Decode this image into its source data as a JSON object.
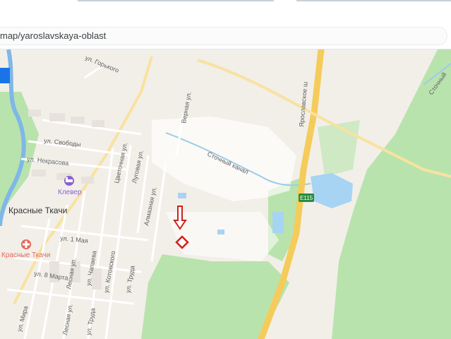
{
  "browser": {
    "url": "map/yaroslavskaya-oblast"
  },
  "map": {
    "colors": {
      "forest": "#b9e3ad",
      "water": "#a7d4f2",
      "highway": "#f5cc5b",
      "marker": "#d0201a",
      "poi": "#8a63d2",
      "hospital": "#e2675b"
    },
    "labels": {
      "town": "Красные Ткачи",
      "poi_klever": "Клевер",
      "poi_clinic": "Красные Ткачи",
      "highway_shield": "E115",
      "road_yaroslavskoe": "Ярославское ш",
      "canal": "Сточный канал",
      "canal_right": "Сточный",
      "st_gorkogo": "ул. Горького",
      "st_svobody": "ул. Свободы",
      "st_nekrasova": "ул. Некрасова",
      "st_1maya": "ул. 1 Мая",
      "st_8marta": "ул. 8 Марта",
      "st_mira": "ул. Мира",
      "st_tsvetochnaya": "Цветочная ул.",
      "st_lugovaya": "Луговая ул.",
      "st_almaznaya": "Алмазная ул.",
      "st_lesnaya": "Лесная ул.",
      "st_chapaeva": "ул. Чапаева",
      "st_lesnaya2": "Лесная ул.",
      "st_kotovskogo": "ул. Котовского",
      "st_truda": "ул. Труда",
      "st_truda2": "ул. Труда",
      "st_vernaya": "Верная ул."
    },
    "icons": [
      "bed-icon",
      "hospital-icon",
      "location-arrow-icon",
      "parcel-marker-icon"
    ]
  }
}
